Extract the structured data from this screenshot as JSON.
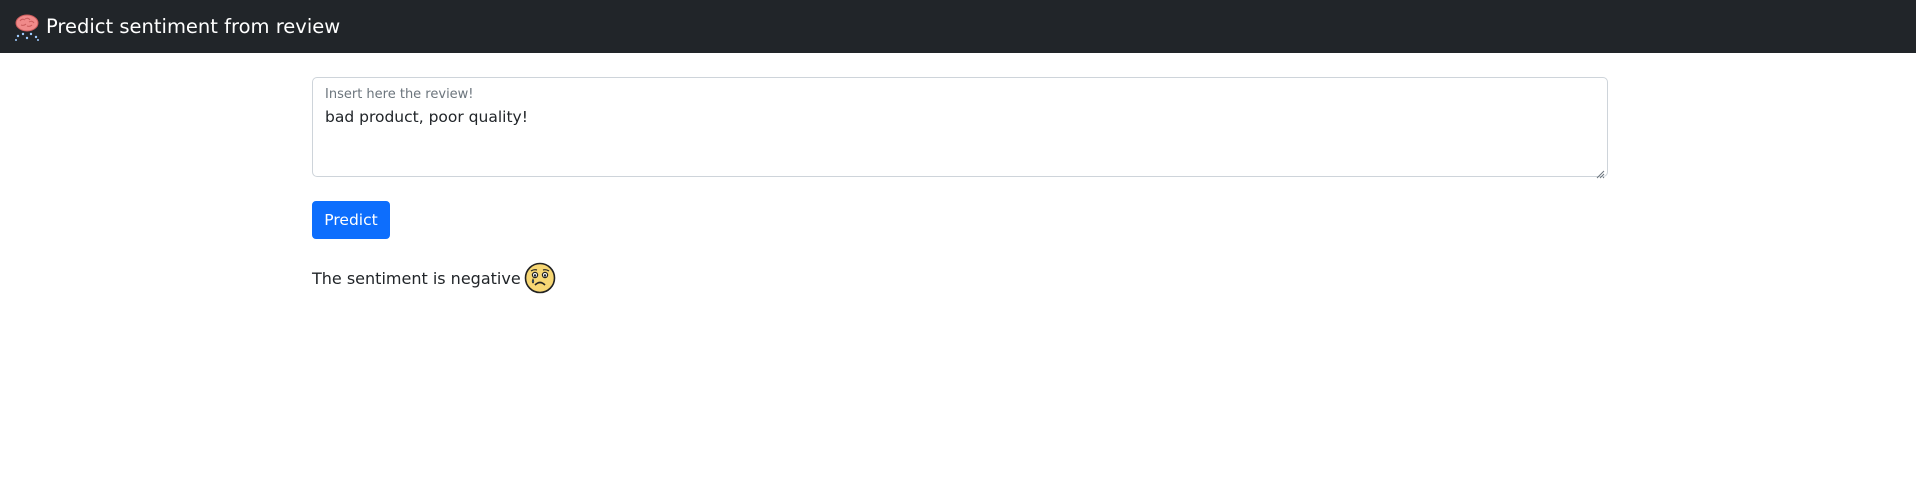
{
  "navbar": {
    "title": "Predict sentiment from review",
    "logo_icon": "brain-icon",
    "background": "#212529"
  },
  "review_form": {
    "label": "Insert here the review!",
    "value": "bad product, poor quality!"
  },
  "predict_button": {
    "label": "Predict",
    "color": "#0d6efd"
  },
  "result": {
    "text": "The sentiment is negative",
    "icon": "crying-face-icon"
  }
}
